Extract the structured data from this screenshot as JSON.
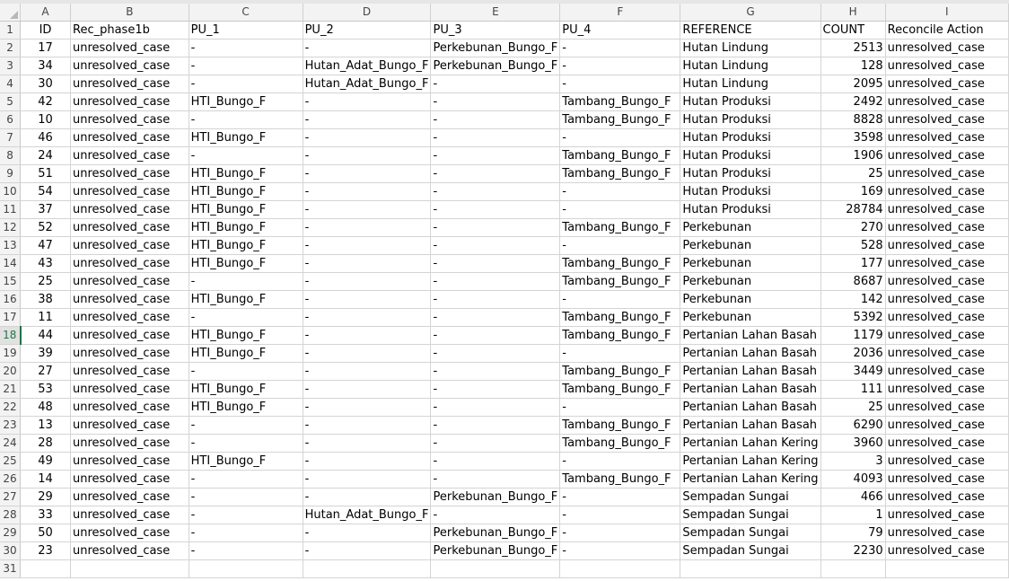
{
  "columns": [
    "A",
    "B",
    "C",
    "D",
    "E",
    "F",
    "G",
    "H",
    "I"
  ],
  "header": [
    "ID",
    "Rec_phase1b",
    "PU_1",
    "PU_2",
    "PU_3",
    "PU_4",
    "REFERENCE",
    "COUNT",
    "Reconcile Action"
  ],
  "rows": [
    [
      "17",
      "unresolved_case",
      "-",
      "-",
      "Perkebunan_Bungo_F",
      "-",
      "Hutan Lindung",
      "2513",
      "unresolved_case"
    ],
    [
      "34",
      "unresolved_case",
      "-",
      "Hutan_Adat_Bungo_F",
      "Perkebunan_Bungo_F",
      "-",
      "Hutan Lindung",
      "128",
      "unresolved_case"
    ],
    [
      "30",
      "unresolved_case",
      "-",
      "Hutan_Adat_Bungo_F",
      "-",
      "-",
      "Hutan Lindung",
      "2095",
      "unresolved_case"
    ],
    [
      "42",
      "unresolved_case",
      "HTI_Bungo_F",
      "-",
      "-",
      "Tambang_Bungo_F",
      "Hutan Produksi",
      "2492",
      "unresolved_case"
    ],
    [
      "10",
      "unresolved_case",
      "-",
      "-",
      "-",
      "Tambang_Bungo_F",
      "Hutan Produksi",
      "8828",
      "unresolved_case"
    ],
    [
      "46",
      "unresolved_case",
      "HTI_Bungo_F",
      "-",
      "-",
      "-",
      "Hutan Produksi",
      "3598",
      "unresolved_case"
    ],
    [
      "24",
      "unresolved_case",
      "-",
      "-",
      "-",
      "Tambang_Bungo_F",
      "Hutan Produksi",
      "1906",
      "unresolved_case"
    ],
    [
      "51",
      "unresolved_case",
      "HTI_Bungo_F",
      "-",
      "-",
      "Tambang_Bungo_F",
      "Hutan Produksi",
      "25",
      "unresolved_case"
    ],
    [
      "54",
      "unresolved_case",
      "HTI_Bungo_F",
      "-",
      "-",
      "-",
      "Hutan Produksi",
      "169",
      "unresolved_case"
    ],
    [
      "37",
      "unresolved_case",
      "HTI_Bungo_F",
      "-",
      "-",
      "-",
      "Hutan Produksi",
      "28784",
      "unresolved_case"
    ],
    [
      "52",
      "unresolved_case",
      "HTI_Bungo_F",
      "-",
      "-",
      "Tambang_Bungo_F",
      "Perkebunan",
      "270",
      "unresolved_case"
    ],
    [
      "47",
      "unresolved_case",
      "HTI_Bungo_F",
      "-",
      "-",
      "-",
      "Perkebunan",
      "528",
      "unresolved_case"
    ],
    [
      "43",
      "unresolved_case",
      "HTI_Bungo_F",
      "-",
      "-",
      "Tambang_Bungo_F",
      "Perkebunan",
      "177",
      "unresolved_case"
    ],
    [
      "25",
      "unresolved_case",
      "-",
      "-",
      "-",
      "Tambang_Bungo_F",
      "Perkebunan",
      "8687",
      "unresolved_case"
    ],
    [
      "38",
      "unresolved_case",
      "HTI_Bungo_F",
      "-",
      "-",
      "-",
      "Perkebunan",
      "142",
      "unresolved_case"
    ],
    [
      "11",
      "unresolved_case",
      "-",
      "-",
      "-",
      "Tambang_Bungo_F",
      "Perkebunan",
      "5392",
      "unresolved_case"
    ],
    [
      "44",
      "unresolved_case",
      "HTI_Bungo_F",
      "-",
      "-",
      "Tambang_Bungo_F",
      "Pertanian Lahan Basah",
      "1179",
      "unresolved_case"
    ],
    [
      "39",
      "unresolved_case",
      "HTI_Bungo_F",
      "-",
      "-",
      "-",
      "Pertanian Lahan Basah",
      "2036",
      "unresolved_case"
    ],
    [
      "27",
      "unresolved_case",
      "-",
      "-",
      "-",
      "Tambang_Bungo_F",
      "Pertanian Lahan Basah",
      "3449",
      "unresolved_case"
    ],
    [
      "53",
      "unresolved_case",
      "HTI_Bungo_F",
      "-",
      "-",
      "Tambang_Bungo_F",
      "Pertanian Lahan Basah",
      "111",
      "unresolved_case"
    ],
    [
      "48",
      "unresolved_case",
      "HTI_Bungo_F",
      "-",
      "-",
      "-",
      "Pertanian Lahan Basah",
      "25",
      "unresolved_case"
    ],
    [
      "13",
      "unresolved_case",
      "-",
      "-",
      "-",
      "Tambang_Bungo_F",
      "Pertanian Lahan Basah",
      "6290",
      "unresolved_case"
    ],
    [
      "28",
      "unresolved_case",
      "-",
      "-",
      "-",
      "Tambang_Bungo_F",
      "Pertanian Lahan Kering",
      "3960",
      "unresolved_case"
    ],
    [
      "49",
      "unresolved_case",
      "HTI_Bungo_F",
      "-",
      "-",
      "-",
      "Pertanian Lahan Kering",
      "3",
      "unresolved_case"
    ],
    [
      "14",
      "unresolved_case",
      "-",
      "-",
      "-",
      "Tambang_Bungo_F",
      "Pertanian Lahan Kering",
      "4093",
      "unresolved_case"
    ],
    [
      "29",
      "unresolved_case",
      "-",
      "-",
      "Perkebunan_Bungo_F",
      "-",
      "Sempadan Sungai",
      "466",
      "unresolved_case"
    ],
    [
      "33",
      "unresolved_case",
      "-",
      "Hutan_Adat_Bungo_F",
      "-",
      "-",
      "Sempadan Sungai",
      "1",
      "unresolved_case"
    ],
    [
      "50",
      "unresolved_case",
      "-",
      "-",
      "Perkebunan_Bungo_F",
      "-",
      "Sempadan Sungai",
      "79",
      "unresolved_case"
    ],
    [
      "23",
      "unresolved_case",
      "-",
      "-",
      "Perkebunan_Bungo_F",
      "-",
      "Sempadan Sungai",
      "2230",
      "unresolved_case"
    ]
  ],
  "selected_row": 18,
  "accent_color": "#217346"
}
